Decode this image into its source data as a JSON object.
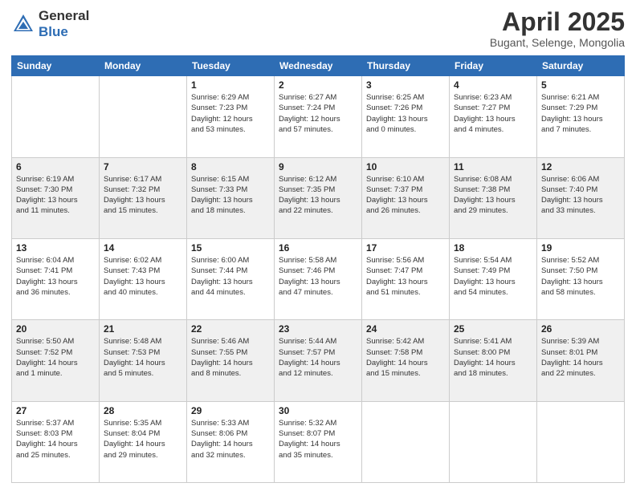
{
  "header": {
    "logo_general": "General",
    "logo_blue": "Blue",
    "title": "April 2025",
    "subtitle": "Bugant, Selenge, Mongolia"
  },
  "days_of_week": [
    "Sunday",
    "Monday",
    "Tuesday",
    "Wednesday",
    "Thursday",
    "Friday",
    "Saturday"
  ],
  "weeks": [
    [
      {
        "day": "",
        "info": ""
      },
      {
        "day": "",
        "info": ""
      },
      {
        "day": "1",
        "info": "Sunrise: 6:29 AM\nSunset: 7:23 PM\nDaylight: 12 hours\nand 53 minutes."
      },
      {
        "day": "2",
        "info": "Sunrise: 6:27 AM\nSunset: 7:24 PM\nDaylight: 12 hours\nand 57 minutes."
      },
      {
        "day": "3",
        "info": "Sunrise: 6:25 AM\nSunset: 7:26 PM\nDaylight: 13 hours\nand 0 minutes."
      },
      {
        "day": "4",
        "info": "Sunrise: 6:23 AM\nSunset: 7:27 PM\nDaylight: 13 hours\nand 4 minutes."
      },
      {
        "day": "5",
        "info": "Sunrise: 6:21 AM\nSunset: 7:29 PM\nDaylight: 13 hours\nand 7 minutes."
      }
    ],
    [
      {
        "day": "6",
        "info": "Sunrise: 6:19 AM\nSunset: 7:30 PM\nDaylight: 13 hours\nand 11 minutes."
      },
      {
        "day": "7",
        "info": "Sunrise: 6:17 AM\nSunset: 7:32 PM\nDaylight: 13 hours\nand 15 minutes."
      },
      {
        "day": "8",
        "info": "Sunrise: 6:15 AM\nSunset: 7:33 PM\nDaylight: 13 hours\nand 18 minutes."
      },
      {
        "day": "9",
        "info": "Sunrise: 6:12 AM\nSunset: 7:35 PM\nDaylight: 13 hours\nand 22 minutes."
      },
      {
        "day": "10",
        "info": "Sunrise: 6:10 AM\nSunset: 7:37 PM\nDaylight: 13 hours\nand 26 minutes."
      },
      {
        "day": "11",
        "info": "Sunrise: 6:08 AM\nSunset: 7:38 PM\nDaylight: 13 hours\nand 29 minutes."
      },
      {
        "day": "12",
        "info": "Sunrise: 6:06 AM\nSunset: 7:40 PM\nDaylight: 13 hours\nand 33 minutes."
      }
    ],
    [
      {
        "day": "13",
        "info": "Sunrise: 6:04 AM\nSunset: 7:41 PM\nDaylight: 13 hours\nand 36 minutes."
      },
      {
        "day": "14",
        "info": "Sunrise: 6:02 AM\nSunset: 7:43 PM\nDaylight: 13 hours\nand 40 minutes."
      },
      {
        "day": "15",
        "info": "Sunrise: 6:00 AM\nSunset: 7:44 PM\nDaylight: 13 hours\nand 44 minutes."
      },
      {
        "day": "16",
        "info": "Sunrise: 5:58 AM\nSunset: 7:46 PM\nDaylight: 13 hours\nand 47 minutes."
      },
      {
        "day": "17",
        "info": "Sunrise: 5:56 AM\nSunset: 7:47 PM\nDaylight: 13 hours\nand 51 minutes."
      },
      {
        "day": "18",
        "info": "Sunrise: 5:54 AM\nSunset: 7:49 PM\nDaylight: 13 hours\nand 54 minutes."
      },
      {
        "day": "19",
        "info": "Sunrise: 5:52 AM\nSunset: 7:50 PM\nDaylight: 13 hours\nand 58 minutes."
      }
    ],
    [
      {
        "day": "20",
        "info": "Sunrise: 5:50 AM\nSunset: 7:52 PM\nDaylight: 14 hours\nand 1 minute."
      },
      {
        "day": "21",
        "info": "Sunrise: 5:48 AM\nSunset: 7:53 PM\nDaylight: 14 hours\nand 5 minutes."
      },
      {
        "day": "22",
        "info": "Sunrise: 5:46 AM\nSunset: 7:55 PM\nDaylight: 14 hours\nand 8 minutes."
      },
      {
        "day": "23",
        "info": "Sunrise: 5:44 AM\nSunset: 7:57 PM\nDaylight: 14 hours\nand 12 minutes."
      },
      {
        "day": "24",
        "info": "Sunrise: 5:42 AM\nSunset: 7:58 PM\nDaylight: 14 hours\nand 15 minutes."
      },
      {
        "day": "25",
        "info": "Sunrise: 5:41 AM\nSunset: 8:00 PM\nDaylight: 14 hours\nand 18 minutes."
      },
      {
        "day": "26",
        "info": "Sunrise: 5:39 AM\nSunset: 8:01 PM\nDaylight: 14 hours\nand 22 minutes."
      }
    ],
    [
      {
        "day": "27",
        "info": "Sunrise: 5:37 AM\nSunset: 8:03 PM\nDaylight: 14 hours\nand 25 minutes."
      },
      {
        "day": "28",
        "info": "Sunrise: 5:35 AM\nSunset: 8:04 PM\nDaylight: 14 hours\nand 29 minutes."
      },
      {
        "day": "29",
        "info": "Sunrise: 5:33 AM\nSunset: 8:06 PM\nDaylight: 14 hours\nand 32 minutes."
      },
      {
        "day": "30",
        "info": "Sunrise: 5:32 AM\nSunset: 8:07 PM\nDaylight: 14 hours\nand 35 minutes."
      },
      {
        "day": "",
        "info": ""
      },
      {
        "day": "",
        "info": ""
      },
      {
        "day": "",
        "info": ""
      }
    ]
  ]
}
